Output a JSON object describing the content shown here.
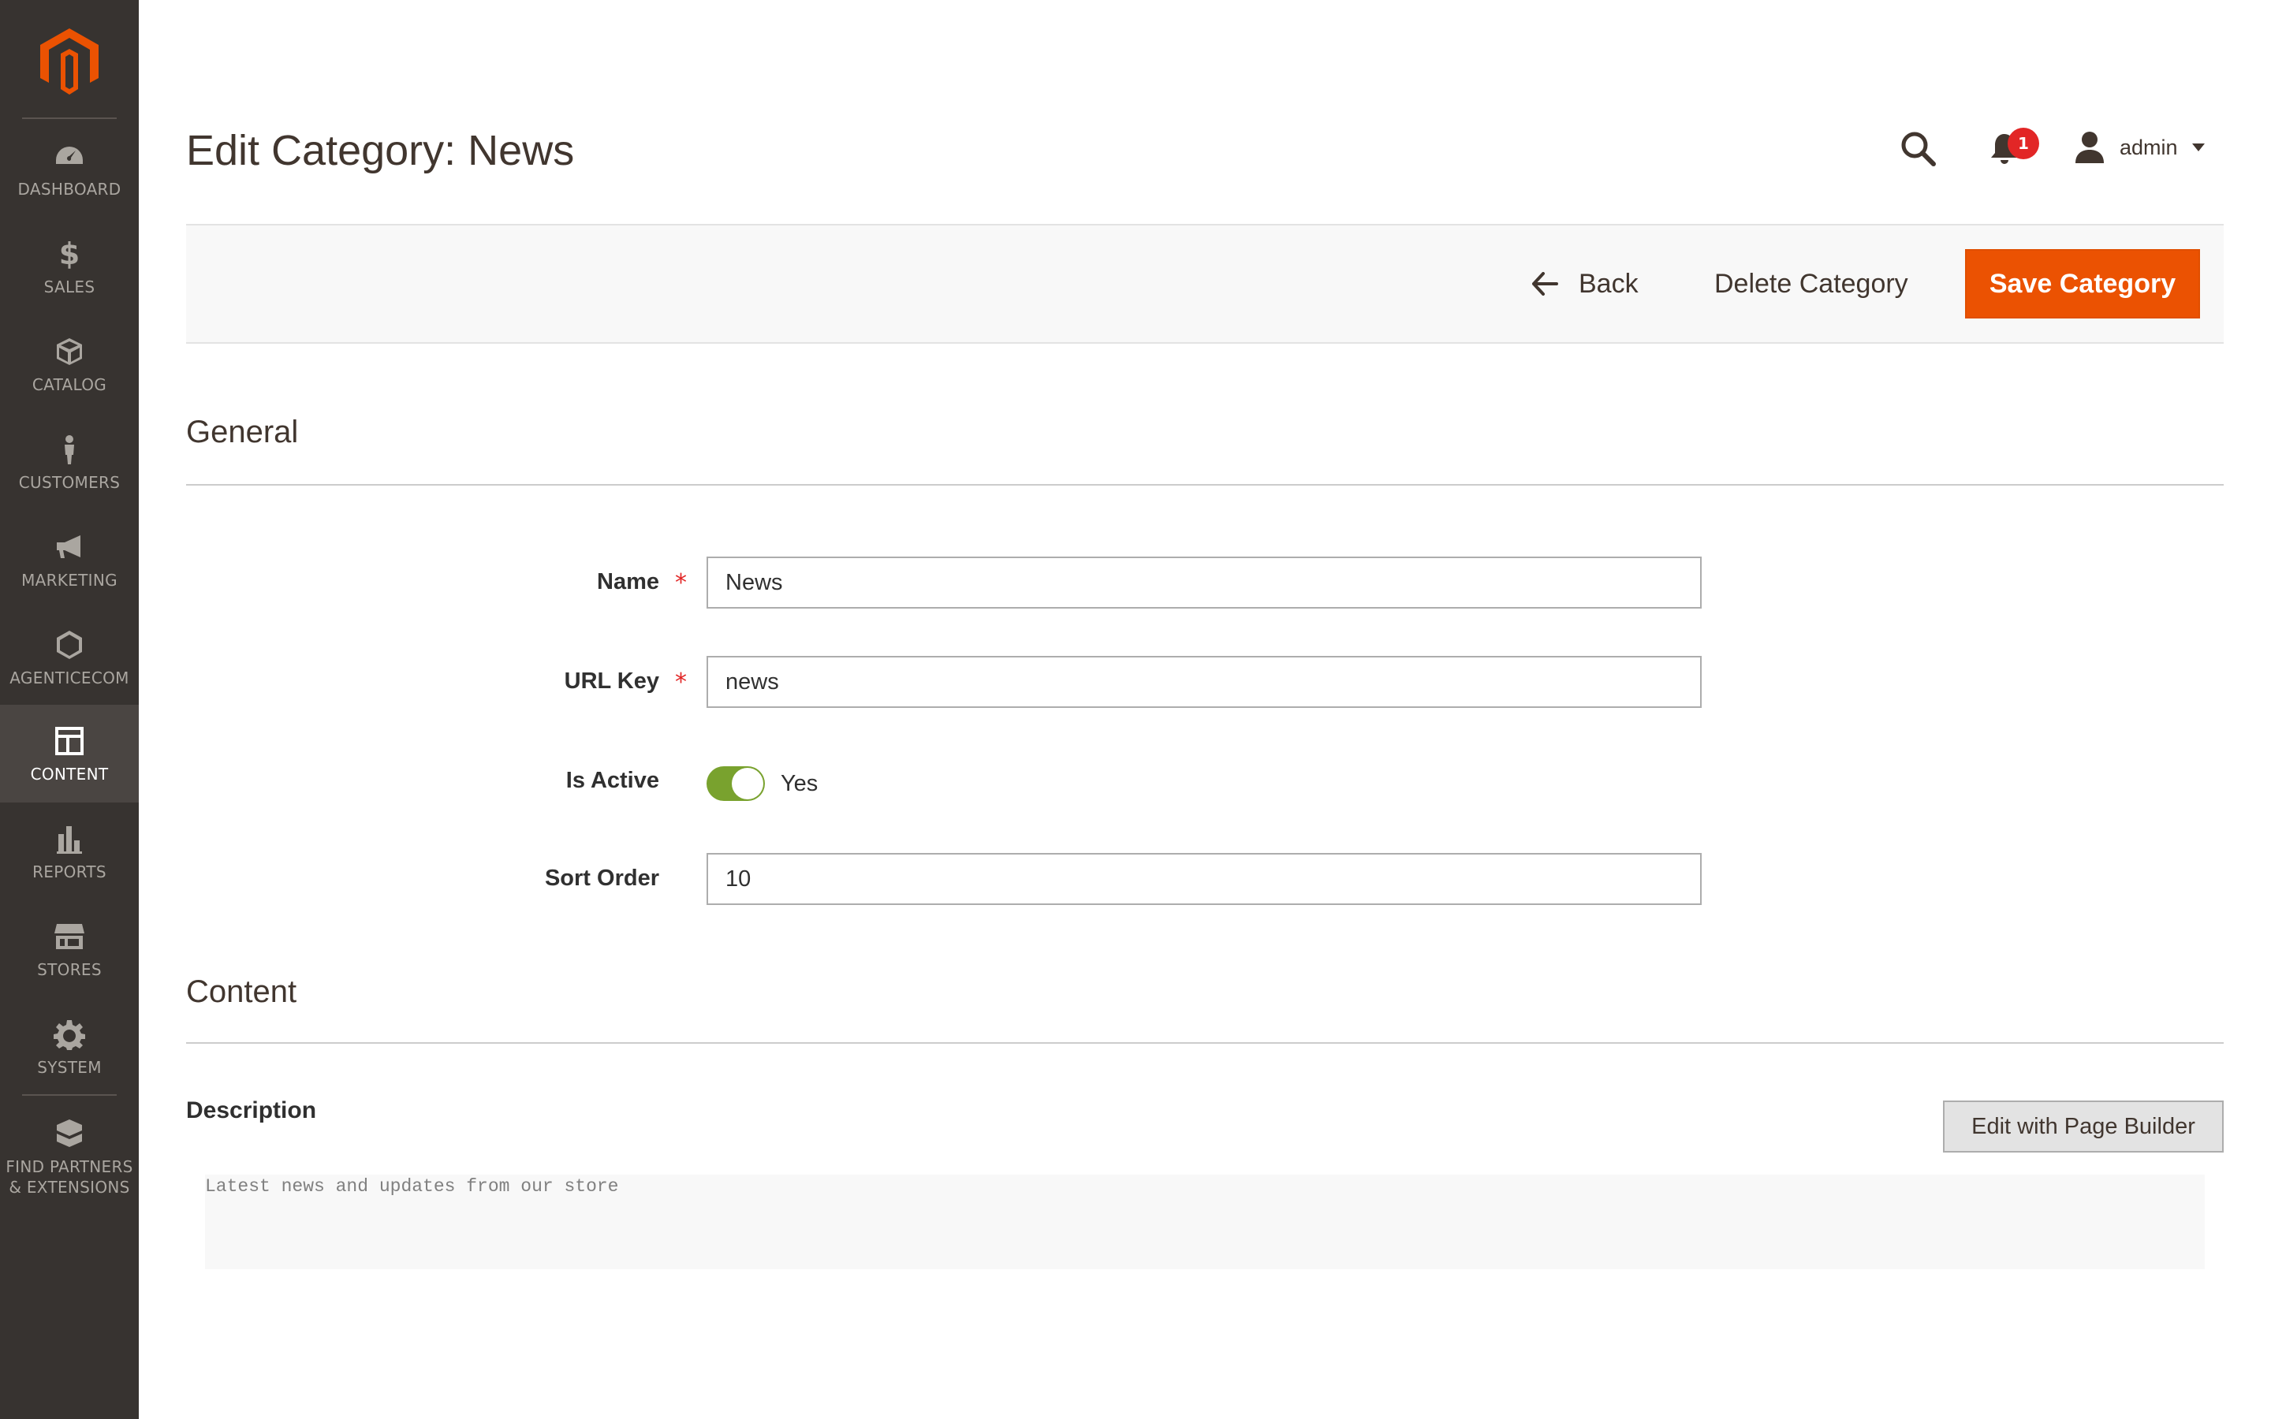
{
  "sidebar": {
    "items": [
      {
        "label": "DASHBOARD",
        "icon": "dashboard-icon"
      },
      {
        "label": "SALES",
        "icon": "dollar-icon"
      },
      {
        "label": "CATALOG",
        "icon": "box-icon"
      },
      {
        "label": "CUSTOMERS",
        "icon": "person-icon"
      },
      {
        "label": "MARKETING",
        "icon": "megaphone-icon"
      },
      {
        "label": "AGENTICECOM",
        "icon": "hexagon-icon"
      },
      {
        "label": "CONTENT",
        "icon": "layout-icon",
        "active": true
      },
      {
        "label": "REPORTS",
        "icon": "bar-chart-icon"
      },
      {
        "label": "STORES",
        "icon": "storefront-icon"
      },
      {
        "label": "SYSTEM",
        "icon": "gear-icon"
      },
      {
        "label": "FIND PARTNERS",
        "label2": "& EXTENSIONS",
        "icon": "blocks-icon"
      }
    ]
  },
  "header": {
    "title": "Edit Category: News",
    "notification_count": "1",
    "user_name": "admin"
  },
  "actions": {
    "back_label": "Back",
    "delete_label": "Delete Category",
    "save_label": "Save Category"
  },
  "general": {
    "title": "General",
    "name_label": "Name",
    "name_value": "News",
    "url_key_label": "URL Key",
    "url_key_value": "news",
    "is_active_label": "Is Active",
    "is_active_value": "Yes",
    "sort_order_label": "Sort Order",
    "sort_order_value": "10"
  },
  "content": {
    "title": "Content",
    "description_label": "Description",
    "page_builder_label": "Edit with Page Builder",
    "description_value": "Latest news and updates from our store"
  },
  "colors": {
    "sidebar_bg": "#373330",
    "accent": "#eb5202",
    "toggle_on": "#79a22e",
    "badge": "#e22626"
  }
}
